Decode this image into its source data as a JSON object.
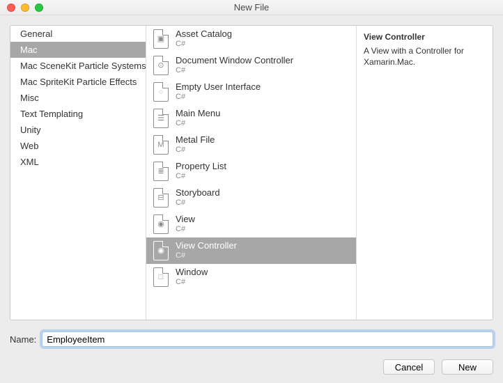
{
  "window": {
    "title": "New File"
  },
  "categories": [
    {
      "label": "General",
      "selected": false
    },
    {
      "label": "Mac",
      "selected": true
    },
    {
      "label": "Mac SceneKit Particle Systems",
      "selected": false
    },
    {
      "label": "Mac SpriteKit Particle Effects",
      "selected": false
    },
    {
      "label": "Misc",
      "selected": false
    },
    {
      "label": "Text Templating",
      "selected": false
    },
    {
      "label": "Unity",
      "selected": false
    },
    {
      "label": "Web",
      "selected": false
    },
    {
      "label": "XML",
      "selected": false
    }
  ],
  "templates": [
    {
      "title": "Asset Catalog",
      "subtitle": "C#",
      "icon": "asset-catalog-icon",
      "glyph": "▣",
      "selected": false
    },
    {
      "title": "Document Window Controller",
      "subtitle": "C#",
      "icon": "document-window-controller-icon",
      "glyph": "⊙",
      "selected": false
    },
    {
      "title": "Empty User Interface",
      "subtitle": "C#",
      "icon": "empty-ui-icon",
      "glyph": "◌",
      "selected": false
    },
    {
      "title": "Main Menu",
      "subtitle": "C#",
      "icon": "main-menu-icon",
      "glyph": "☰",
      "selected": false
    },
    {
      "title": "Metal File",
      "subtitle": "C#",
      "icon": "metal-file-icon",
      "glyph": "M",
      "selected": false
    },
    {
      "title": "Property List",
      "subtitle": "C#",
      "icon": "property-list-icon",
      "glyph": "≣",
      "selected": false
    },
    {
      "title": "Storyboard",
      "subtitle": "C#",
      "icon": "storyboard-icon",
      "glyph": "⊟",
      "selected": false
    },
    {
      "title": "View",
      "subtitle": "C#",
      "icon": "view-icon",
      "glyph": "◉",
      "selected": false
    },
    {
      "title": "View Controller",
      "subtitle": "C#",
      "icon": "view-controller-icon",
      "glyph": "◉",
      "selected": true
    },
    {
      "title": "Window",
      "subtitle": "C#",
      "icon": "window-icon",
      "glyph": "□",
      "selected": false
    }
  ],
  "detail": {
    "title": "View Controller",
    "description": "A View with a Controller for Xamarin.Mac."
  },
  "name_field": {
    "label": "Name:",
    "value": "EmployeeItem"
  },
  "buttons": {
    "cancel": "Cancel",
    "new": "New"
  }
}
